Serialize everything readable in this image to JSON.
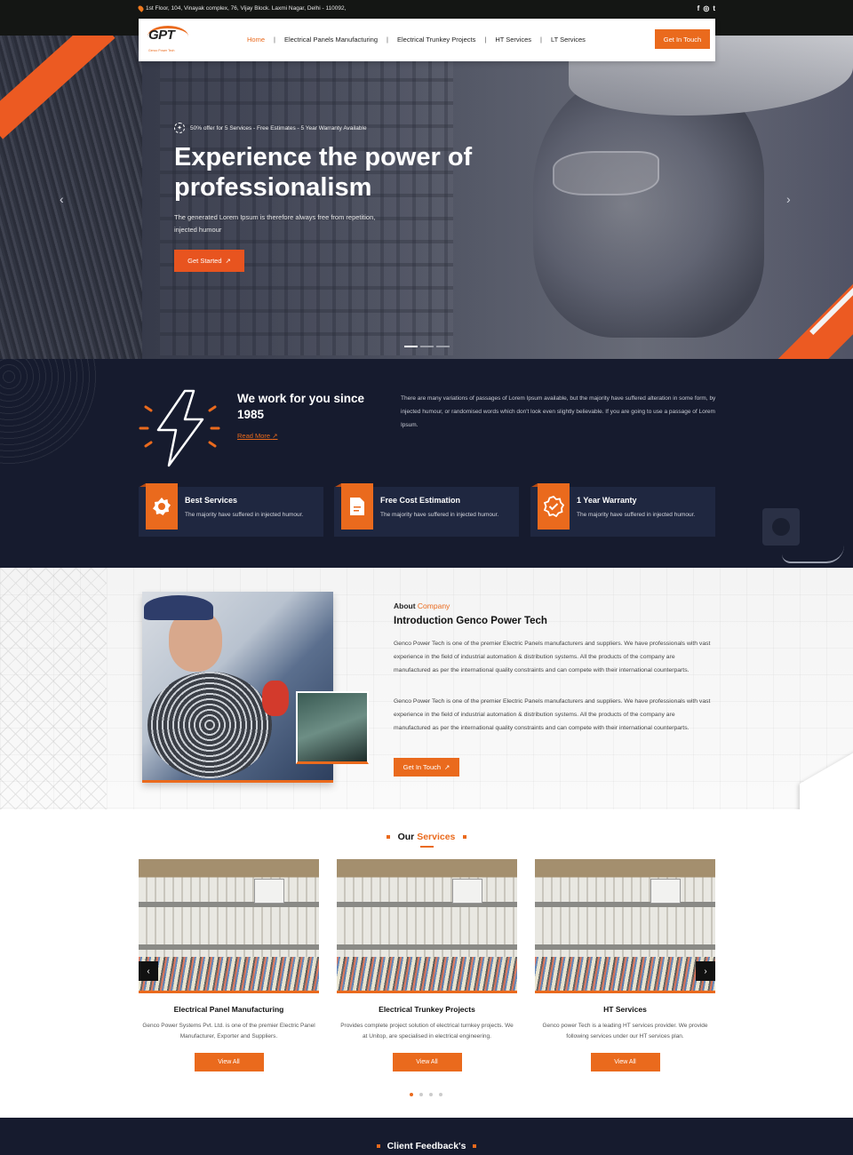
{
  "topbar": {
    "address": "1st Floor, 104, Vinayak complex, 76, Vijay Block. Laxmi Nagar, Delhi - 110092,",
    "social": [
      "f",
      "◎",
      "t"
    ]
  },
  "nav": {
    "logo_text": "GPT",
    "logo_tagline": "Genco Power Tech",
    "items": [
      {
        "label": "Home",
        "active": true
      },
      {
        "label": "Electrical Panels Manufacturing",
        "active": false
      },
      {
        "label": "Electrical Trunkey Projects",
        "active": false
      },
      {
        "label": "HT Services",
        "active": false
      },
      {
        "label": "LT Services",
        "active": false
      }
    ],
    "cta": "Get In Touch"
  },
  "hero": {
    "offer": "50% offer for 5 Services - Free Estimates - 5 Year Warranty Available",
    "title": "Experience the power of professionalism",
    "subtitle": "The generated Lorem Ipsum is therefore always free from repetition, injected humour",
    "button": "Get Started",
    "arrow_left": "‹",
    "arrow_right": "›",
    "slide_count": 3,
    "active_slide": 1
  },
  "about_strip": {
    "title": "We work for you since 1985",
    "read_more": "Read More",
    "paragraph": "There are many variations of passages of Lorem Ipsum available, but the majority have suffered alteration in some form, by injected humour, or randomised words which don't look even slightly believable. If you are going to use a passage of Lorem Ipsum.",
    "features": [
      {
        "icon": "badge-icon",
        "title": "Best Services",
        "desc": "The majority have suffered in injected humour."
      },
      {
        "icon": "document-icon",
        "title": "Free Cost Estimation",
        "desc": "The majority have suffered in injected humour."
      },
      {
        "icon": "check-badge-icon",
        "title": "1 Year Warranty",
        "desc": "The majority have suffered in injected humour."
      }
    ]
  },
  "about": {
    "label": "About",
    "label_highlight": "Company",
    "title": "Introduction Genco Power Tech",
    "paragraphs": [
      "Genco Power Tech is one of the premier Electric Panels manufacturers and suppliers. We have professionals with vast experience in the field of industrial automation & distribution systems. All the products of the company are manufactured as per the international quality constraints and can compete with their international counterparts.",
      "Genco Power Tech is one of the premier Electric Panels manufacturers and suppliers. We have professionals with vast experience in the field of industrial automation & distribution systems. All the products of the company are manufactured as per the international quality constraints and can compete with their international counterparts."
    ],
    "button": "Get In Touch"
  },
  "services": {
    "heading": "Our",
    "heading_highlight": "Services",
    "cards": [
      {
        "title": "Electrical Panel Manufacturing",
        "desc": "Genco Power Systems Pvt. Ltd. is one of the premier Electric Panel Manufacturer, Exporter and Suppliers.",
        "button": "View All"
      },
      {
        "title": "Electrical Trunkey Projects",
        "desc": "Provides complete project solution of electrical turnkey projects. We at Unitop, are specialised in electrical engineering.",
        "button": "View All"
      },
      {
        "title": "HT Services",
        "desc": "Genco power Tech is a leading HT services provider. We provide following services under our HT services plan.",
        "button": "View All"
      }
    ],
    "prev": "‹",
    "next": "›",
    "dot_count": 4,
    "active_dot": 1
  },
  "feedback": {
    "heading": "Client Feedback's"
  },
  "colors": {
    "accent": "#ea6a1d",
    "dark": "#161b2e",
    "topbar": "#141614"
  }
}
